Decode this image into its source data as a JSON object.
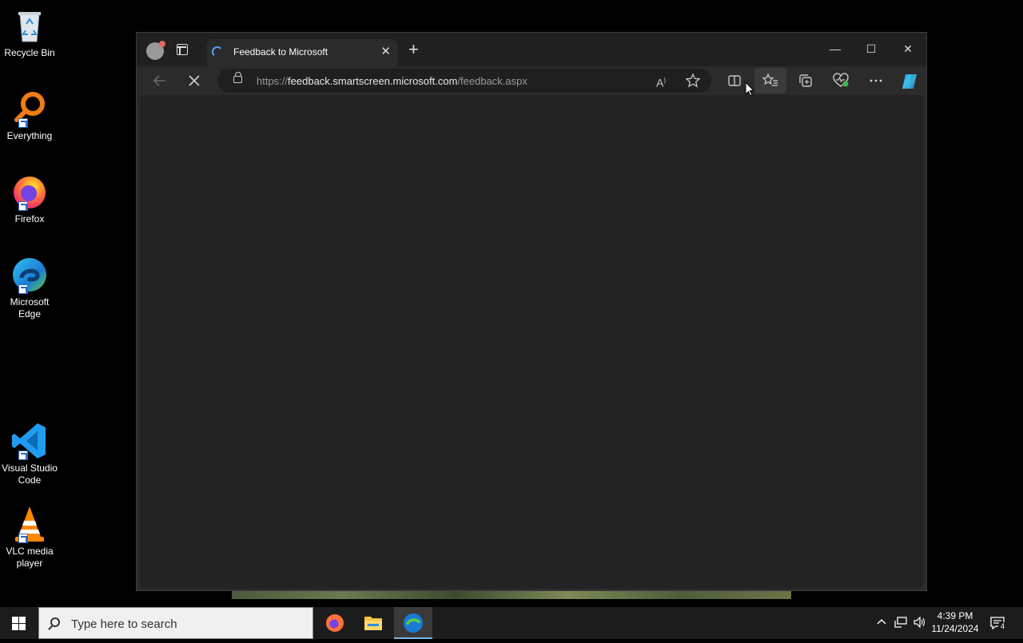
{
  "desktop": {
    "icons": [
      {
        "label": "Recycle Bin"
      },
      {
        "label": "Everything"
      },
      {
        "label": "Firefox"
      },
      {
        "label": "Microsoft Edge"
      },
      {
        "label": "Visual Studio Code"
      },
      {
        "label": "VLC media player"
      }
    ]
  },
  "browser": {
    "tab": {
      "title": "Feedback to Microsoft",
      "close": "✕"
    },
    "new_tab": "+",
    "window_controls": {
      "minimize": "—",
      "maximize": "☐",
      "close": "✕"
    },
    "address": {
      "scheme": "https://",
      "host": "feedback.smartscreen.microsoft.com",
      "path": "/feedback.aspx"
    },
    "toolbar_icons": [
      "back-icon",
      "stop-loading-icon",
      "read-aloud-icon",
      "add-favorite-icon",
      "split-screen-icon",
      "favorites-icon",
      "collections-icon",
      "browser-essentials-icon",
      "more-icon",
      "copilot-icon"
    ]
  },
  "taskbar": {
    "search_placeholder": "Type here to search",
    "time": "4:39 PM",
    "date": "11/24/2024",
    "notification_count": "4"
  }
}
